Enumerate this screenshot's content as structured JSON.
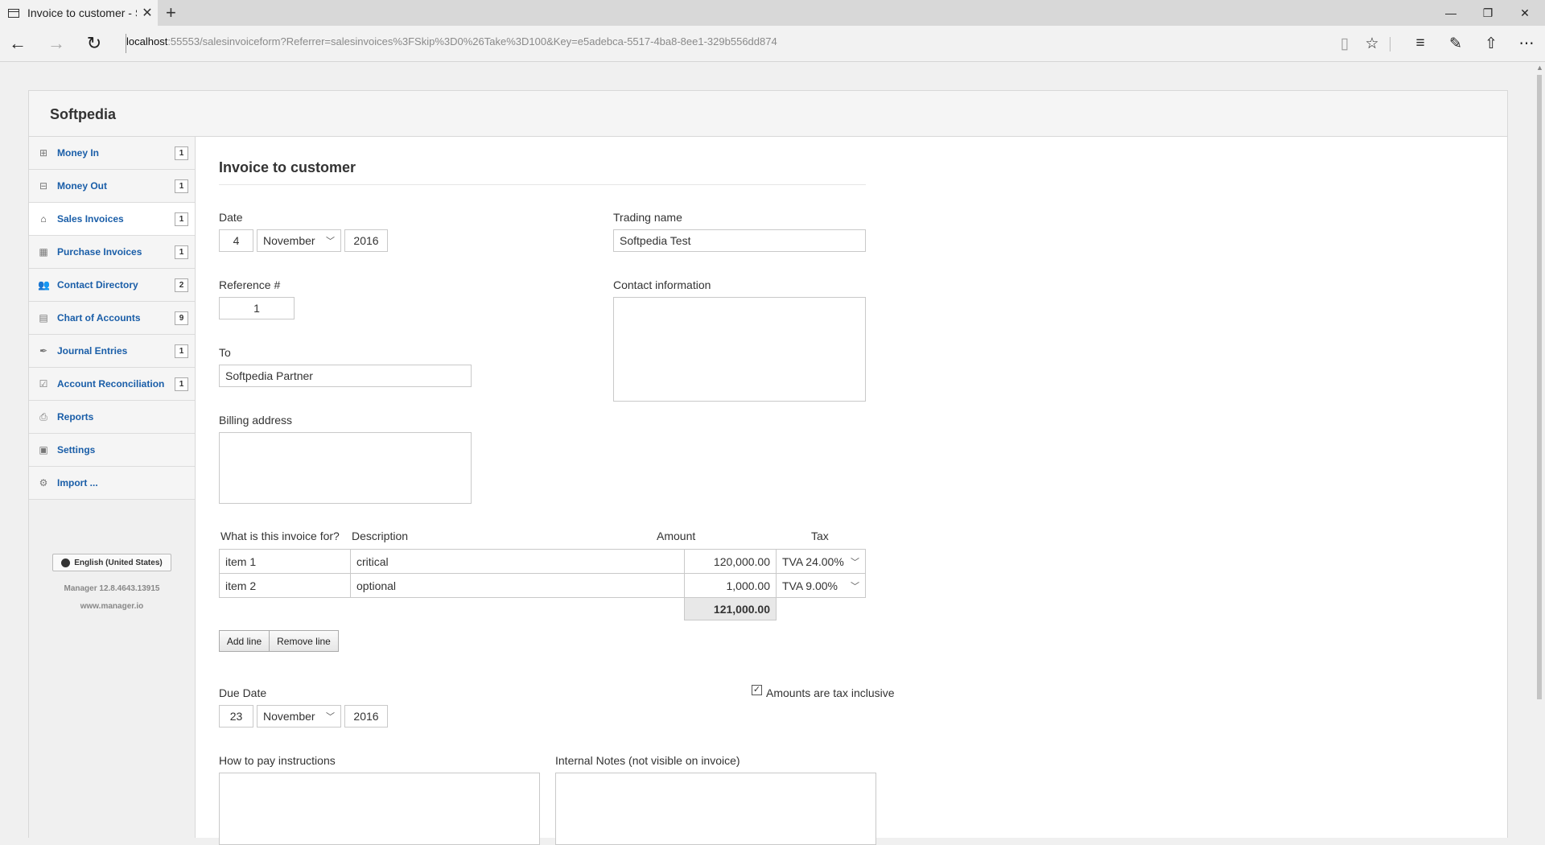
{
  "browser": {
    "tab_title": "Invoice to customer - So",
    "new_tab": "+",
    "url_host": "localhost",
    "url_rest": ":55553/salesinvoiceform?Referrer=salesinvoices%3FSkip%3D0%26Take%3D100&Key=e5adebca-5517-4ba8-8ee1-329b556dd874"
  },
  "app": {
    "brand": "Softpedia",
    "sidebar": {
      "items": [
        {
          "label": "Money In",
          "badge": "1",
          "icon": "money-in-icon"
        },
        {
          "label": "Money Out",
          "badge": "1",
          "icon": "money-out-icon"
        },
        {
          "label": "Sales Invoices",
          "badge": "1",
          "icon": "sales-invoices-icon"
        },
        {
          "label": "Purchase Invoices",
          "badge": "1",
          "icon": "purchase-invoices-icon"
        },
        {
          "label": "Contact Directory",
          "badge": "2",
          "icon": "contacts-icon"
        },
        {
          "label": "Chart of Accounts",
          "badge": "9",
          "icon": "chart-of-accounts-icon"
        },
        {
          "label": "Journal Entries",
          "badge": "1",
          "icon": "journal-icon"
        },
        {
          "label": "Account Reconciliation",
          "badge": "1",
          "icon": "reconciliation-icon"
        },
        {
          "label": "Reports",
          "badge": "",
          "icon": "printer-icon"
        },
        {
          "label": "Settings",
          "badge": "",
          "icon": "settings-icon"
        },
        {
          "label": "Import ...",
          "badge": "",
          "icon": "import-icon"
        }
      ],
      "language": "English (United States)",
      "version": "Manager 12.8.4643.13915",
      "website": "www.manager.io"
    }
  },
  "form": {
    "title": "Invoice to customer",
    "date_label": "Date",
    "date": {
      "day": "4",
      "month": "November",
      "year": "2016"
    },
    "reference_label": "Reference #",
    "reference": "1",
    "to_label": "To",
    "to": "Softpedia Partner",
    "billing_label": "Billing address",
    "trading_label": "Trading name",
    "trading_name": "Softpedia Test",
    "contact_label": "Contact information",
    "lines": {
      "headers": {
        "item": "What is this invoice for?",
        "description": "Description",
        "amount": "Amount",
        "tax": "Tax"
      },
      "rows": [
        {
          "item": "item 1",
          "description": "critical",
          "amount": "120,000.00",
          "tax": "TVA 24.00%"
        },
        {
          "item": "item 2",
          "description": "optional",
          "amount": "1,000.00",
          "tax": "TVA 9.00%"
        }
      ],
      "total": "121,000.00"
    },
    "add_line": "Add line",
    "remove_line": "Remove line",
    "due_label": "Due Date",
    "due": {
      "day": "23",
      "month": "November",
      "year": "2016"
    },
    "tax_inclusive_label": "Amounts are tax inclusive",
    "tax_inclusive": true,
    "howtopay_label": "How to pay instructions",
    "notes_label": "Internal Notes (not visible on invoice)"
  }
}
